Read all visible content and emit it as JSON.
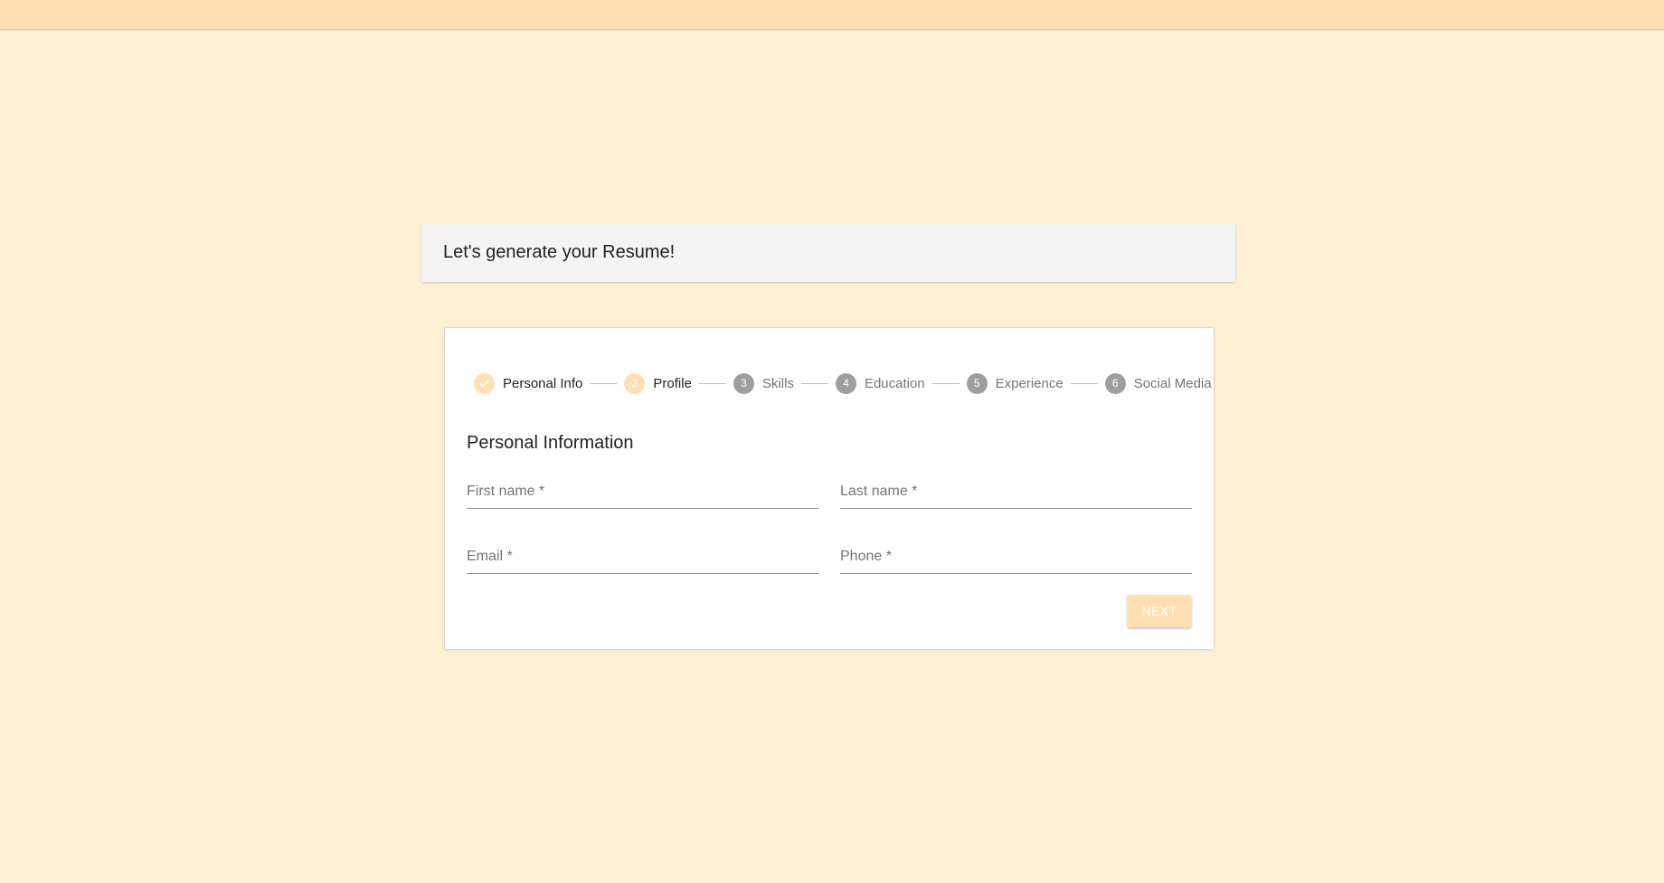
{
  "header": {
    "title": "Let's generate your Resume!"
  },
  "stepper": {
    "steps": [
      {
        "number": "1",
        "label": "Personal Info",
        "state": "completed",
        "icon": "check-icon"
      },
      {
        "number": "2",
        "label": "Profile",
        "state": "active"
      },
      {
        "number": "3",
        "label": "Skills",
        "state": "inactive"
      },
      {
        "number": "4",
        "label": "Education",
        "state": "inactive"
      },
      {
        "number": "5",
        "label": "Experience",
        "state": "inactive"
      },
      {
        "number": "6",
        "label": "Social Media",
        "state": "inactive"
      }
    ]
  },
  "form": {
    "section_title": "Personal Information",
    "fields": {
      "first_name": {
        "label": "First name *",
        "value": ""
      },
      "last_name": {
        "label": "Last name *",
        "value": ""
      },
      "email": {
        "label": "Email *",
        "value": ""
      },
      "phone": {
        "label": "Phone *",
        "value": ""
      }
    },
    "next_label": "NEXT"
  },
  "colors": {
    "background": "#ffefd5",
    "accent": "#ffe0b2",
    "inactive_step": "#9e9e9e"
  }
}
